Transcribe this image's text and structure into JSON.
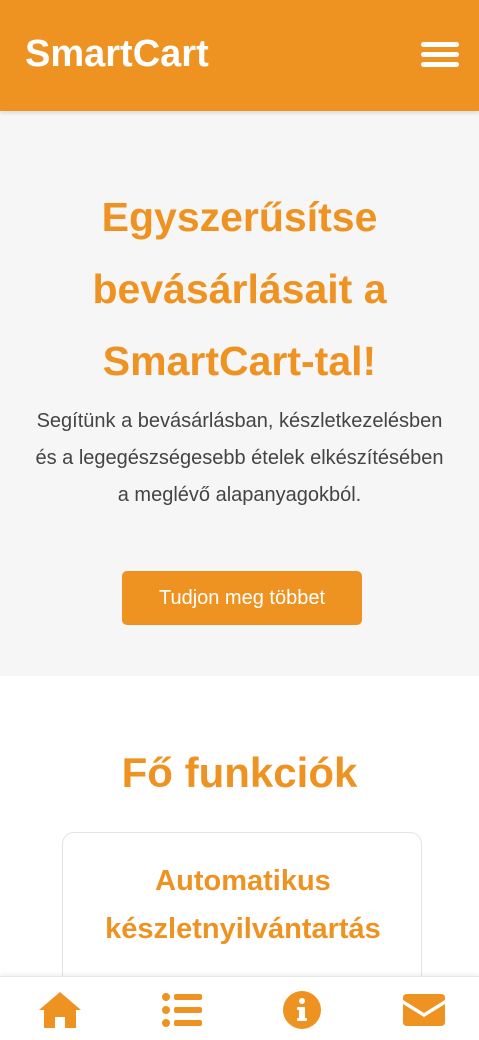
{
  "header": {
    "brand": "SmartCart",
    "menu_icon": "hamburger-menu-icon"
  },
  "hero": {
    "title": "Egyszerűsítse bevásárlásait a SmartCart-tal!",
    "description": "Segítünk a bevásárlásban, készletkezelésben és a legegészségesebb ételek elkészítésében a meglévő alapanyagokból.",
    "cta_label": "Tudjon meg többet"
  },
  "features": {
    "title": "Fő funkciók",
    "cards": [
      {
        "title": "Automatikus készletnyilvántartás"
      }
    ]
  },
  "bottom_nav": {
    "items": [
      {
        "icon": "home-icon"
      },
      {
        "icon": "list-icon"
      },
      {
        "icon": "info-icon"
      },
      {
        "icon": "mail-icon"
      }
    ]
  },
  "colors": {
    "accent": "#ee9322",
    "hero_background": "#f6f6f6",
    "text": "#444444"
  }
}
